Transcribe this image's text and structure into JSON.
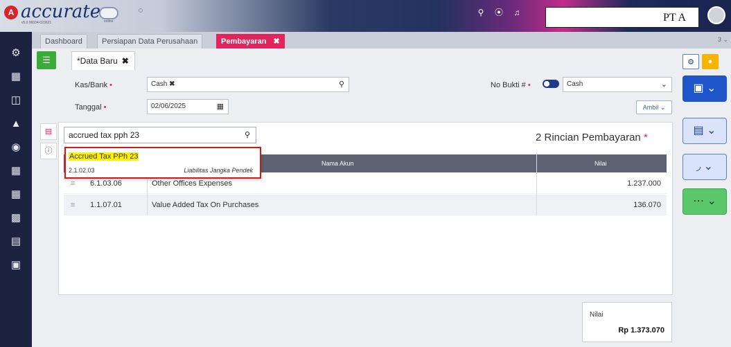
{
  "header": {
    "logo_badge": "A",
    "brand": "accurate",
    "brand_sub": "v5.0 99334-023621",
    "cloud_label": "online",
    "company": "PT A",
    "icons": [
      "search-icon",
      "help-icon",
      "bell-icon"
    ]
  },
  "sidebar": {
    "icons": [
      "settings-icon",
      "building-icon",
      "calculator-icon",
      "bank-icon",
      "coin-icon",
      "cart-icon",
      "cart-out-icon",
      "chart-icon",
      "report-icon",
      "layers-icon"
    ]
  },
  "module_tabs": [
    {
      "label": "Dashboard",
      "active": false
    },
    {
      "label": "Persiapan Data Perusahaan",
      "active": false
    },
    {
      "label": "Pembayaran",
      "active": true,
      "close": "✖"
    }
  ],
  "tabs_more": "3 ⌄",
  "doc_tab": {
    "label": "Data Baru",
    "close": "✖",
    "marker": "*"
  },
  "form": {
    "kas_bank_label": "Kas/Bank",
    "kas_bank_value": "Cash",
    "kas_bank_chip_close": "✖",
    "tanggal_label": "Tanggal",
    "tanggal_value": "02/06/2025",
    "no_bukti_label": "No Bukti #",
    "no_bukti_value": "Cash",
    "ambil_label": "Ambil",
    "required_mark": "•"
  },
  "detail": {
    "search_value": "accrued tax pph 23",
    "title": "2 Rincian Pembayaran",
    "title_mark": "*",
    "columns": [
      "Nama Akun",
      "Nilai"
    ],
    "rows": [
      {
        "code": "6.1.03.06",
        "name": "Other Offices Expenses",
        "value": "1.237.000"
      },
      {
        "code": "1.1.07.01",
        "name": "Value Added Tax On Purchases",
        "value": "136.070"
      }
    ]
  },
  "suggestion": {
    "name": "Accrued Tax PPh 23",
    "code": "2.1.02.03",
    "category": "Liabilitas Jangka Pendek"
  },
  "total": {
    "label": "Nilai",
    "value": "Rp 1.373.070"
  },
  "colors": {
    "accent": "#e0245c",
    "sidebar": "#1b2340",
    "save": "#1e56c9",
    "highlight": "#fff200",
    "suggestion_border": "#d11a1a"
  }
}
